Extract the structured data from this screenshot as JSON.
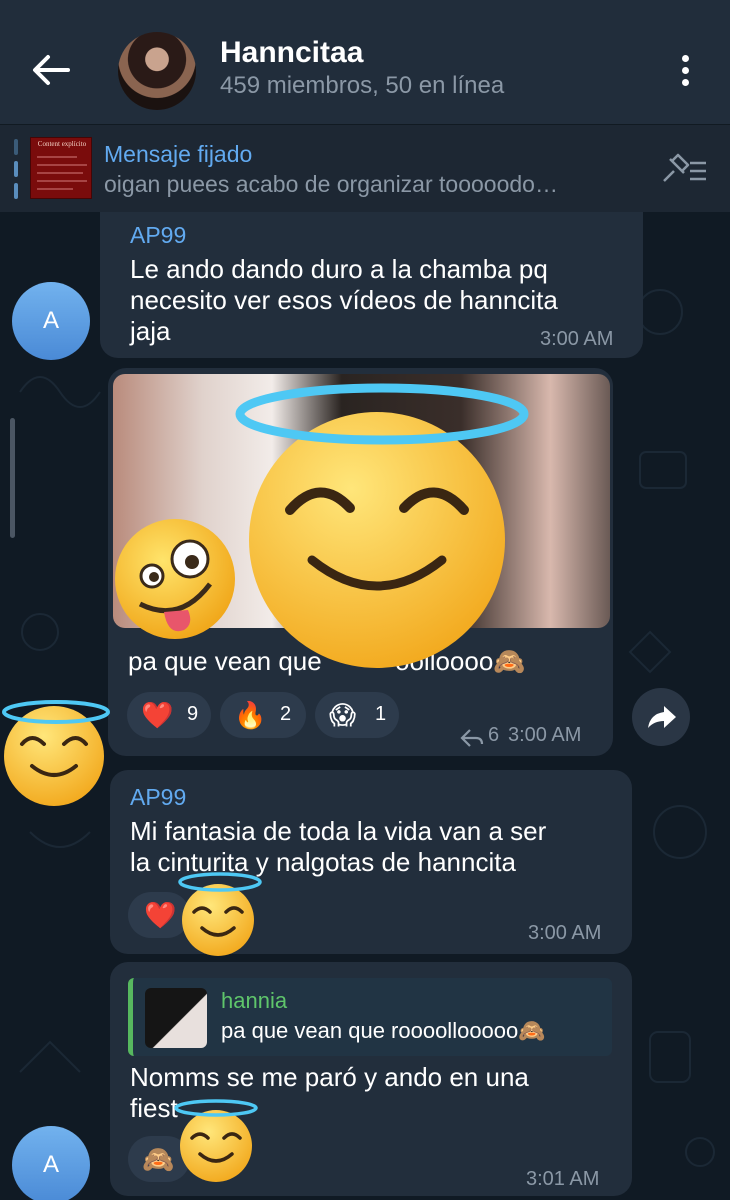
{
  "header": {
    "title": "Hanncitaa",
    "subtitle": "459 miembros, 50 en línea"
  },
  "pinned": {
    "label": "Mensaje fijado",
    "text": "oigan puees acabo de organizar tooooodo…",
    "thumb_title": "Content explícito"
  },
  "messages": [
    {
      "sender": "AP99",
      "lines": [
        "Le ando dando duro a la chamba pq",
        "necesito ver esos vídeos de hanncita",
        "jaja"
      ],
      "time": "3:00 AM",
      "avatar_letter": "A"
    },
    {
      "caption": "pa que vean que ",
      "caption_tail": "oolloooo🙈",
      "reactions": [
        {
          "emoji": "❤️",
          "count": "9"
        },
        {
          "emoji": "🔥",
          "count": "2"
        },
        {
          "emoji": "😱",
          "count": "1"
        }
      ],
      "replies": "6",
      "time": "3:00 AM"
    },
    {
      "sender": "AP99",
      "lines": [
        "Mi fantasia de toda la vida van a ser",
        "la cinturita y nalgotas de hanncita"
      ],
      "reaction": "❤️",
      "time": "3:00 AM"
    },
    {
      "reply_to": {
        "name": "hannia",
        "text": "pa que vean que roooollooooo🙈"
      },
      "lines": [
        "Nomms se me paró y ando en una",
        "fiest"
      ],
      "reaction": "🙈",
      "time": "3:01 AM",
      "avatar_letter": "A"
    }
  ]
}
